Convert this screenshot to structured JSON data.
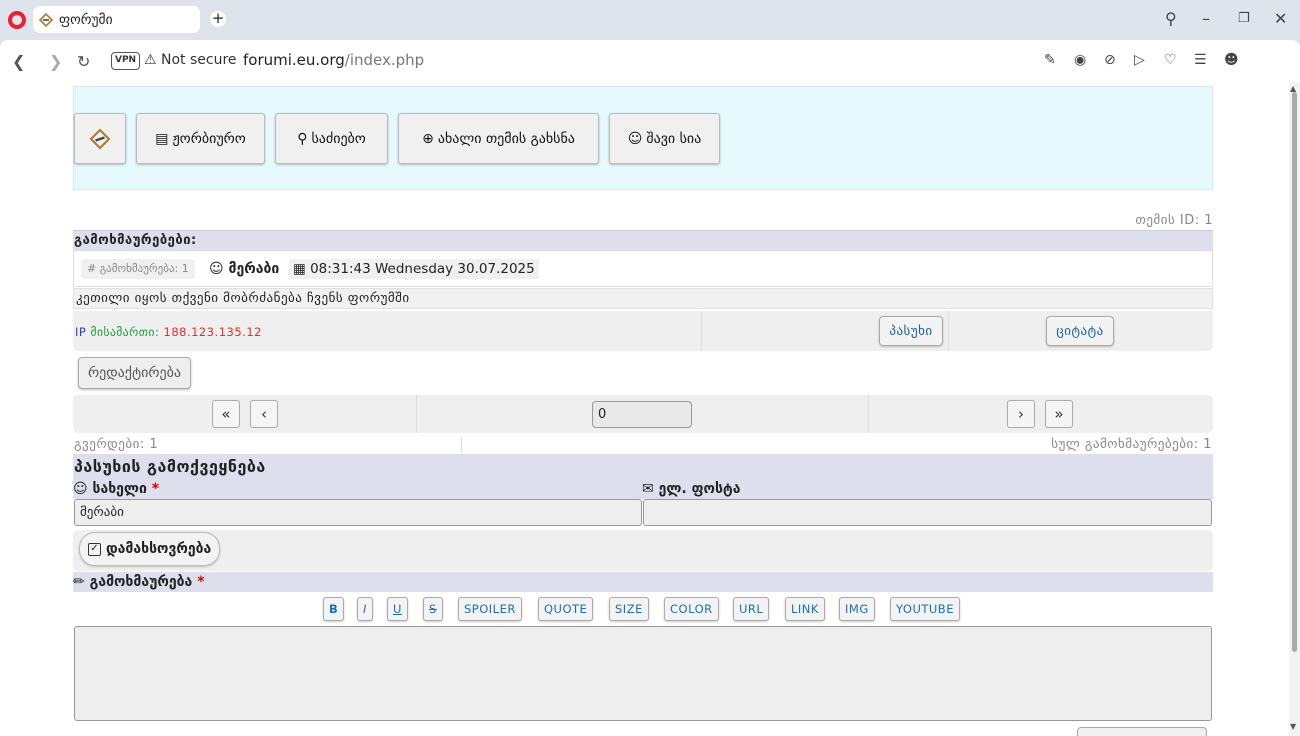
{
  "browser": {
    "tab_title": "ფორუმი",
    "vpn_label": "VPN",
    "security_label": "Not secure",
    "url_host": "forumi.eu.org",
    "url_path": "/index.php"
  },
  "nav": {
    "forum_label": "ჟორბიურო",
    "search_label": "საძიებო",
    "new_topic_label": "ახალი თემის გახსნა",
    "blacklist_label": "შავი სია"
  },
  "topic": {
    "id_line": "თემის ID: 1",
    "replies_header": "გამოხმაურებები:"
  },
  "post": {
    "reply_chip": "# გამოხმაურება: 1",
    "author": "მერაბი",
    "datetime": "08:31:43 Wednesday 30.07.2025",
    "message": "კეთილი იყოს თქვენი მობრძანება ჩვენს ფორუმში",
    "ip_prefix": "IP",
    "ip_label": "მისამართი:",
    "ip_value": "188.123.135.12",
    "reply_button": "პასუხი",
    "quote_button": "ციტატა",
    "edit_button": "რედაქტირება"
  },
  "pager": {
    "page_input": "0",
    "pages_text": "გვერდები: 1",
    "total_text": "სულ გამოხმაურებები: 1"
  },
  "reply_form": {
    "title": "პასუხის გამოქვეყნება",
    "name_label": "სახელი",
    "required_mark": "*",
    "email_label": "ელ. ფოსტა",
    "name_value": "მერაბი",
    "remember_label": "დამახსოვრება",
    "comment_label": "გამოხმაურება",
    "toolbar": [
      "B",
      "I",
      "U",
      "S",
      "SPOILER",
      "QUOTE",
      "SIZE",
      "COLOR",
      "URL",
      "LINK",
      "IMG",
      "YOUTUBE"
    ]
  },
  "colors": {
    "nav_bg": "#e6fafe",
    "band_bg": "#dde0ec",
    "link_blue": "#1a6fb0",
    "ip_red": "#e0302f",
    "ip_green": "#1a9a3a"
  }
}
